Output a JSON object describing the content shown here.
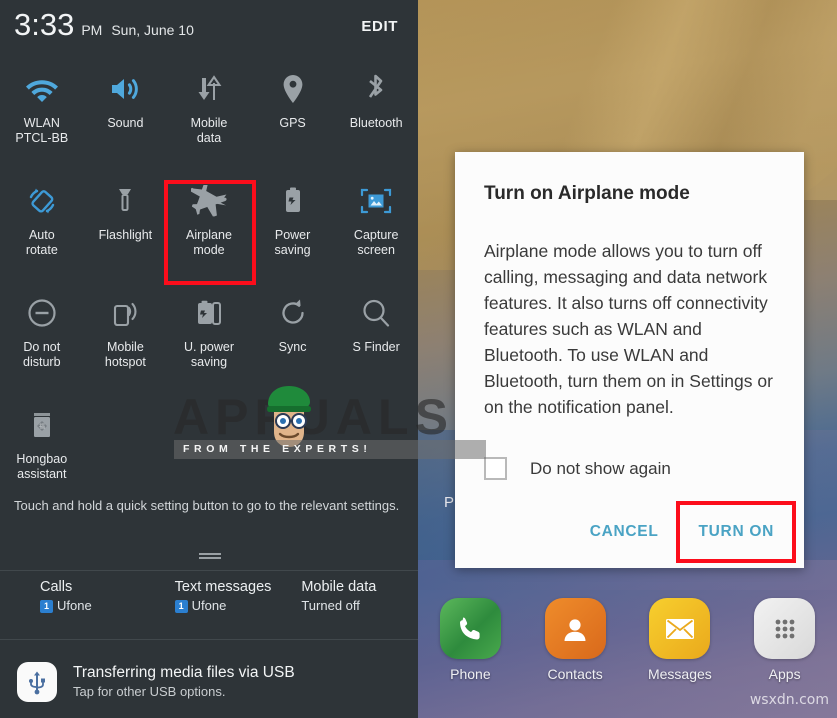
{
  "status_bar": {
    "time": "3:33",
    "ampm": "PM",
    "date": "Sun, June 10",
    "edit_label": "EDIT"
  },
  "quick_settings": {
    "rows": [
      [
        {
          "icon": "wifi-icon",
          "label": "WLAN",
          "sub": "PTCL-BB",
          "active": true
        },
        {
          "icon": "volume-icon",
          "label": "Sound",
          "sub": "",
          "active": true
        },
        {
          "icon": "mobile-data-icon",
          "label": "Mobile",
          "sub": "data",
          "active": false
        },
        {
          "icon": "location-pin-icon",
          "label": "GPS",
          "sub": "",
          "active": false
        },
        {
          "icon": "bluetooth-icon",
          "label": "Bluetooth",
          "sub": "",
          "active": false
        }
      ],
      [
        {
          "icon": "auto-rotate-icon",
          "label": "Auto",
          "sub": "rotate",
          "active": true
        },
        {
          "icon": "flashlight-icon",
          "label": "Flashlight",
          "sub": "",
          "active": false
        },
        {
          "icon": "airplane-icon",
          "label": "Airplane",
          "sub": "mode",
          "active": false,
          "highlighted": true
        },
        {
          "icon": "battery-saving-icon",
          "label": "Power",
          "sub": "saving",
          "active": false
        },
        {
          "icon": "capture-screen-icon",
          "label": "Capture",
          "sub": "screen",
          "active": true
        }
      ],
      [
        {
          "icon": "do-not-disturb-icon",
          "label": "Do not",
          "sub": "disturb",
          "active": false
        },
        {
          "icon": "hotspot-icon",
          "label": "Mobile",
          "sub": "hotspot",
          "active": false
        },
        {
          "icon": "ultra-power-saving-icon",
          "label": "U. power",
          "sub": "saving",
          "active": false
        },
        {
          "icon": "sync-icon",
          "label": "Sync",
          "sub": "",
          "active": false
        },
        {
          "icon": "search-icon",
          "label": "S Finder",
          "sub": "",
          "active": false
        }
      ],
      [
        {
          "icon": "hongbao-icon",
          "label": "Hongbao",
          "sub": "assistant",
          "active": false
        }
      ]
    ],
    "hint_text": "Touch and hold a quick setting button to go to the relevant settings."
  },
  "carrier_row": [
    {
      "title": "Calls",
      "badge": "1",
      "sub": "Ufone"
    },
    {
      "title": "Text messages",
      "badge": "1",
      "sub": "Ufone"
    },
    {
      "title": "Mobile data",
      "badge": "",
      "sub": "Turned off"
    }
  ],
  "usb_notification": {
    "icon": "usb-icon",
    "title": "Transferring media files via USB",
    "subtitle": "Tap for other USB options."
  },
  "dialog": {
    "title": "Turn on Airplane mode",
    "body": "Airplane mode allows you to turn off calling, messaging and data network features. It also turns off connectivity features such as WLAN and Bluetooth. To use WLAN and Bluetooth, turn them on in Settings or on the notification panel.",
    "checkbox_label": "Do not show again",
    "checkbox_checked": false,
    "cancel_label": "CANCEL",
    "confirm_label": "TURN ON",
    "confirm_highlighted": true
  },
  "home_screen": {
    "partial_label": "P",
    "dock": [
      {
        "icon": "phone-icon",
        "label": "Phone",
        "color": "#43a047"
      },
      {
        "icon": "contacts-icon",
        "label": "Contacts",
        "color": "#e67e22"
      },
      {
        "icon": "messages-icon",
        "label": "Messages",
        "color": "#f5c518"
      },
      {
        "icon": "apps-grid-icon",
        "label": "Apps",
        "color": "#e8e8e8"
      }
    ]
  },
  "watermarks": {
    "brand": "APPUALS",
    "tagline": "FROM THE EXPERTS!",
    "site": "wsxdn.com"
  },
  "colors": {
    "panel_bg": "#2e3438",
    "accent_blue": "#4fa8dc",
    "icon_gray": "#9aa1a6",
    "highlight_red": "#fc0d1b",
    "dialog_action": "#4aa3c4"
  }
}
